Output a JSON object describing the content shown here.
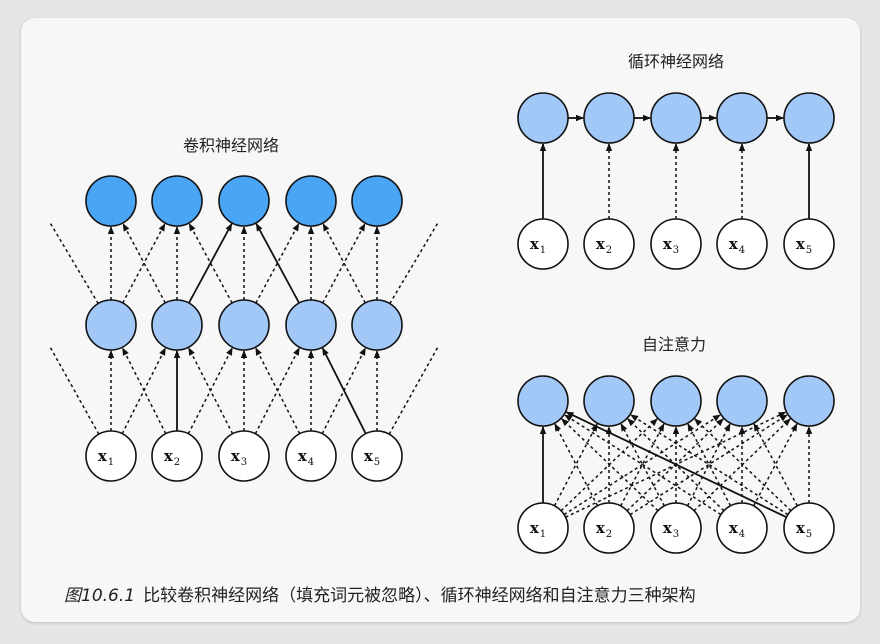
{
  "panels": {
    "cnn": {
      "title": "卷积神经网络"
    },
    "rnn": {
      "title": "循环神经网络"
    },
    "attention": {
      "title": "自注意力"
    }
  },
  "inputs": {
    "symbol": "x",
    "indices": [
      "1",
      "2",
      "3",
      "4",
      "5"
    ]
  },
  "colors": {
    "output_node": "#4ba5f5",
    "hidden_node": "#a2c8f7",
    "input_node": "#ffffff",
    "stroke": "#111111"
  },
  "caption": {
    "figure_number": "图10.6.1",
    "text": "比较卷积神经网络（填充词元被忽略）、循环神经网络和自注意力三种架构"
  }
}
